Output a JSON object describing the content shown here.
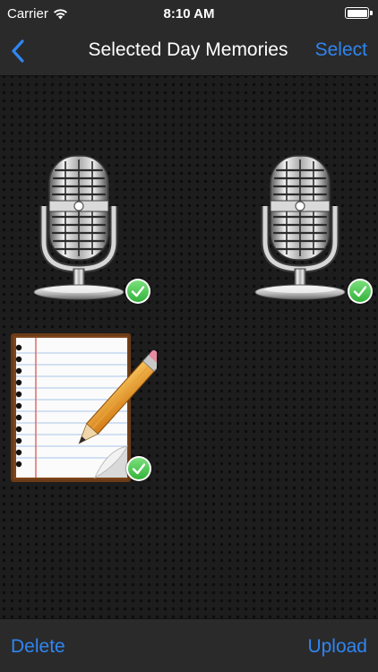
{
  "status_bar": {
    "carrier": "Carrier",
    "time": "8:10 AM",
    "battery_level": 1.0,
    "wifi_icon": "wifi-icon",
    "battery_icon": "battery-icon"
  },
  "nav": {
    "back_icon": "chevron-left-icon",
    "title": "Selected Day Memories",
    "select_label": "Select"
  },
  "grid": {
    "items": [
      {
        "type": "audio",
        "icon": "microphone-icon",
        "selected": true
      },
      {
        "type": "audio",
        "icon": "microphone-icon",
        "selected": true
      },
      {
        "type": "note",
        "icon": "notepad-pencil-icon",
        "selected": true
      }
    ]
  },
  "toolbar": {
    "delete_label": "Delete",
    "upload_label": "Upload"
  },
  "colors": {
    "accent": "#2f86f0",
    "bar_background": "#2a2a2b",
    "check_green": "#4cd964"
  }
}
